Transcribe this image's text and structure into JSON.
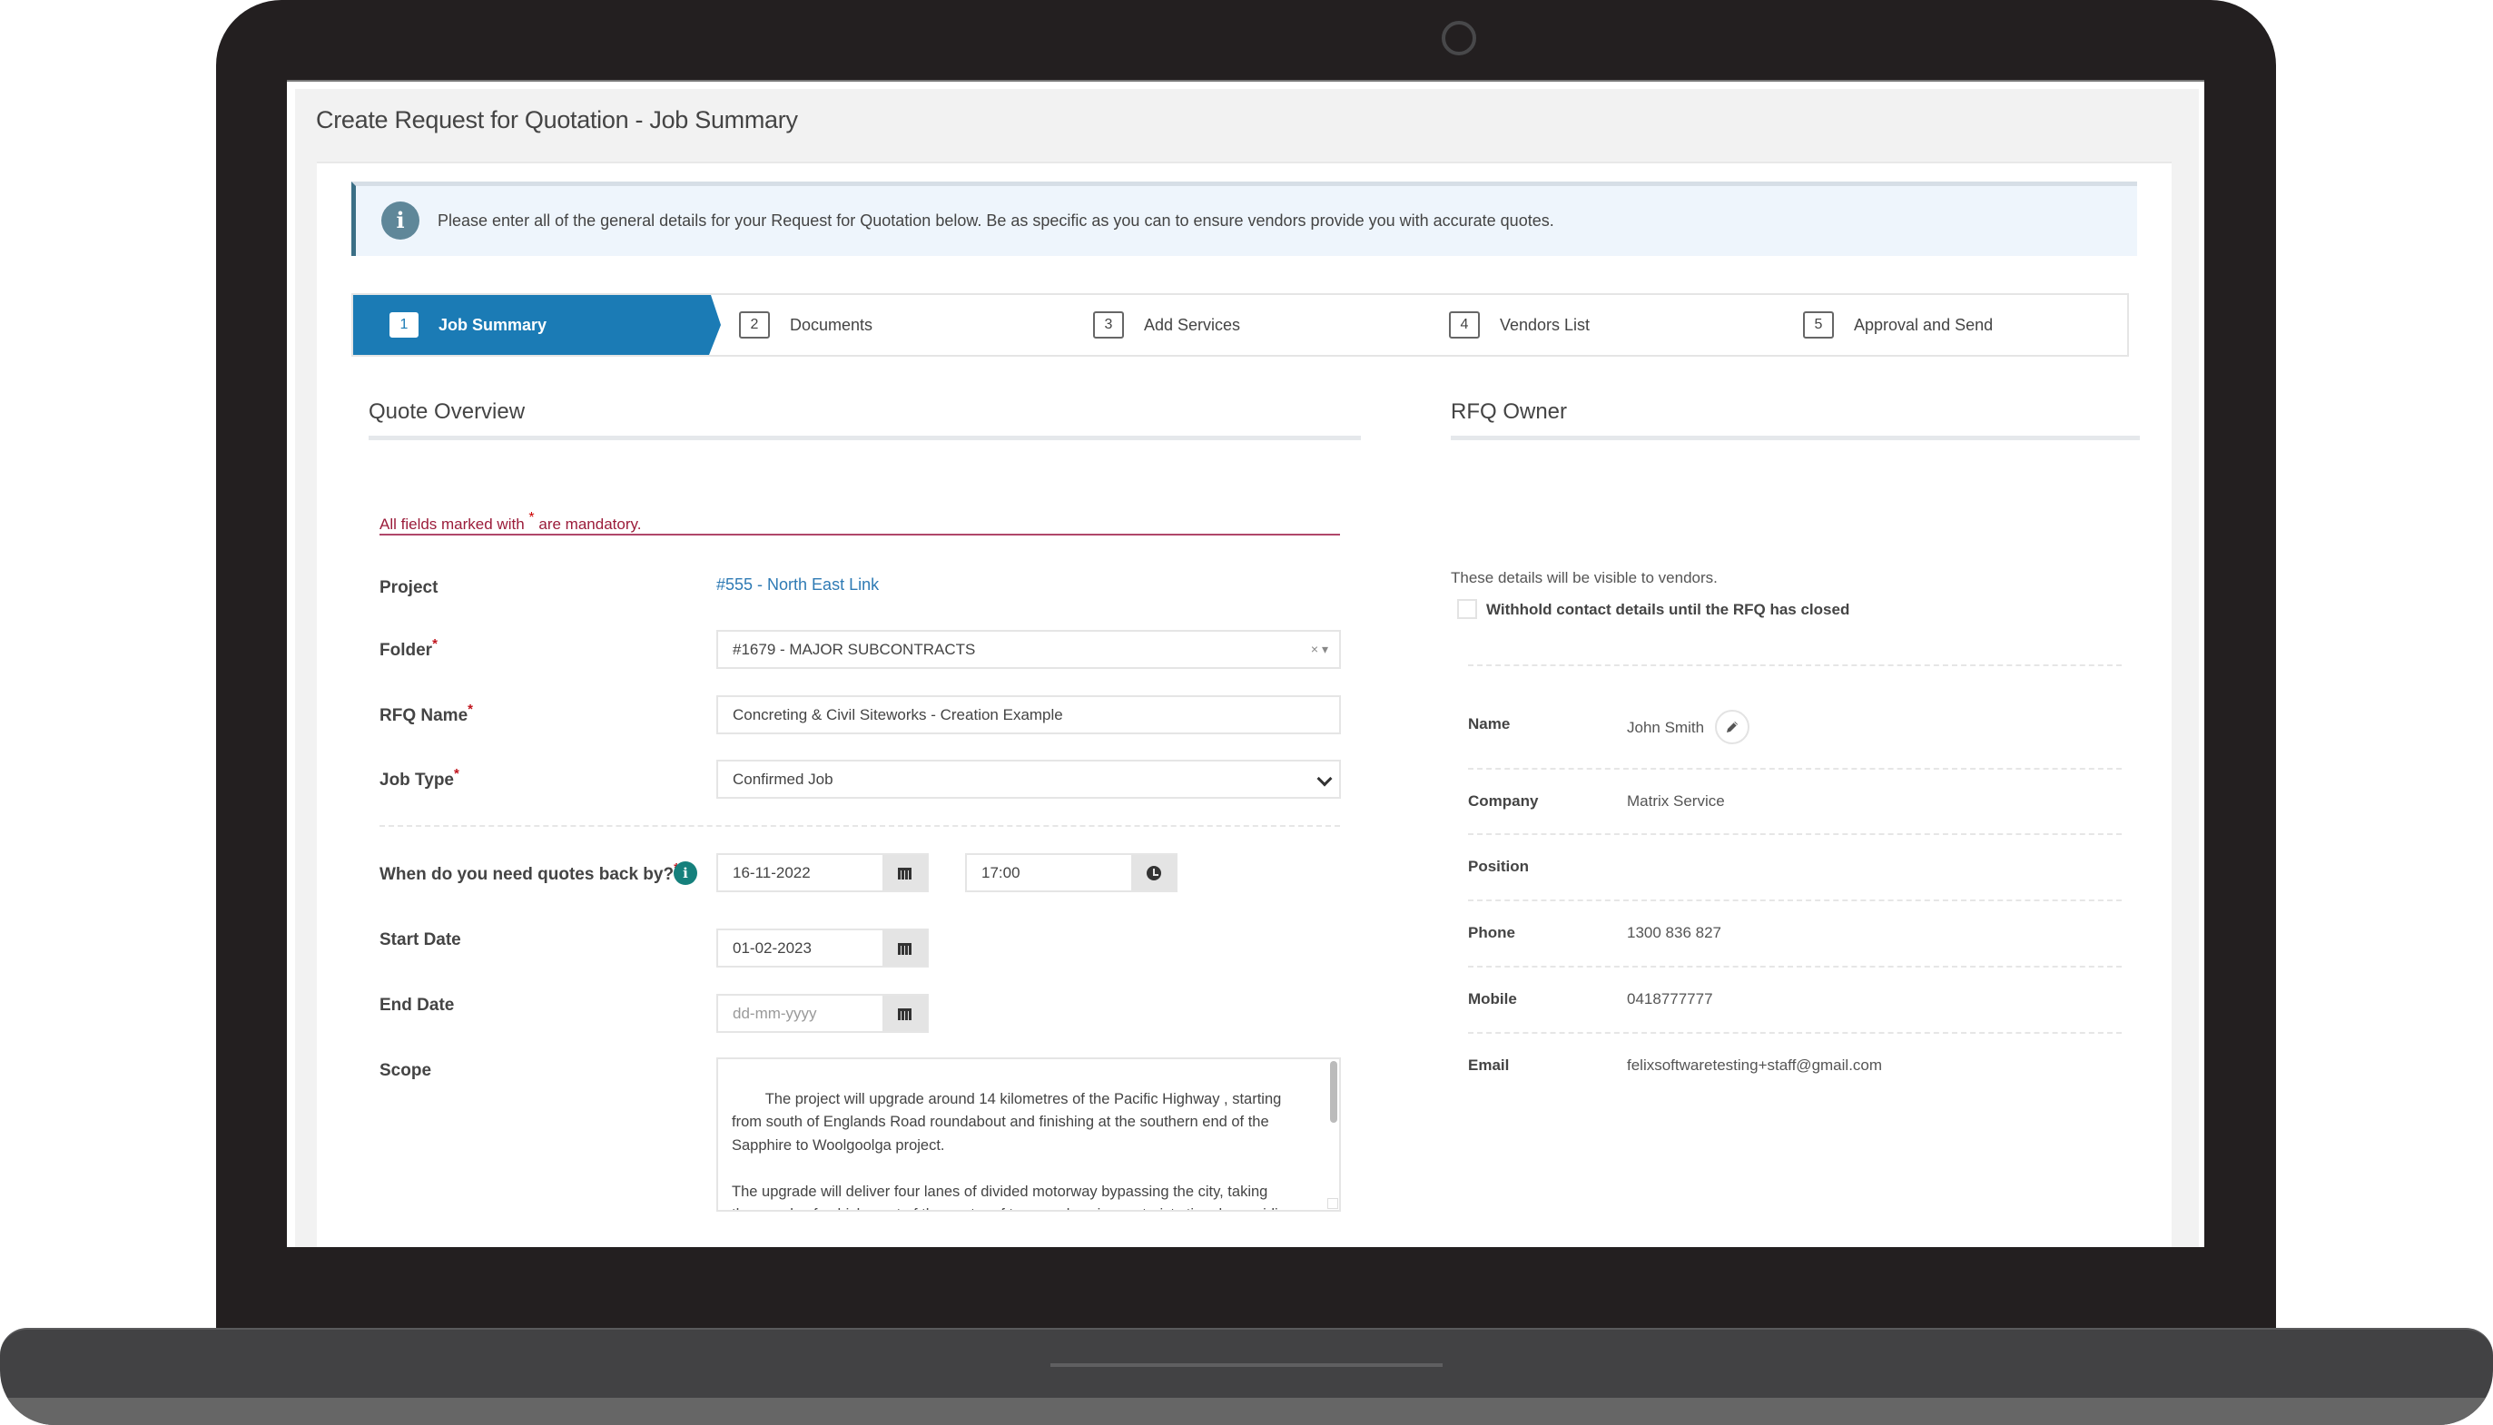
{
  "page": {
    "title": "Create Request for Quotation - Job Summary"
  },
  "banner": {
    "icon": "info-icon",
    "text": "Please enter all of the general details for your Request for Quotation below. Be as specific as you can to ensure vendors provide you with accurate quotes."
  },
  "steps": [
    {
      "num": "1",
      "label": "Job Summary",
      "active": true
    },
    {
      "num": "2",
      "label": "Documents",
      "active": false
    },
    {
      "num": "3",
      "label": "Add Services",
      "active": false
    },
    {
      "num": "4",
      "label": "Vendors List",
      "active": false
    },
    {
      "num": "5",
      "label": "Approval and Send",
      "active": false
    }
  ],
  "quote_overview": {
    "title": "Quote Overview",
    "mandatory_note_before": "All fields marked with",
    "mandatory_star": "*",
    "mandatory_note_after": "are mandatory.",
    "required_marker": "*",
    "project": {
      "label": "Project",
      "value": "#555 - North East Link"
    },
    "folder": {
      "label": "Folder",
      "value": "#1679 - MAJOR SUBCONTRACTS",
      "clear": "×",
      "caret": "▾"
    },
    "rfq_name": {
      "label": "RFQ Name",
      "value": "Concreting & Civil Siteworks - Creation Example"
    },
    "job_type": {
      "label": "Job Type",
      "value": "Confirmed Job"
    },
    "quotes_back_by": {
      "label": "When do you need quotes back by?",
      "date": "16-11-2022",
      "time": "17:00",
      "info": "i"
    },
    "start_date": {
      "label": "Start Date",
      "value": "01-02-2023"
    },
    "end_date": {
      "label": "End Date",
      "placeholder": "dd-mm-yyyy"
    },
    "scope": {
      "label": "Scope",
      "value": "The project will upgrade around 14 kilometres of the Pacific Highway , starting from south of Englands Road roundabout and finishing at the southern end of the Sapphire to Woolgoolga project.\n\nThe upgrade will deliver four lanes of divided motorway bypassing the city, taking thousands of vehicles out of the centre of town and saving motorists time by avoiding ... [text continues, cut off]"
    }
  },
  "rfq_owner": {
    "title": "RFQ Owner",
    "description": "These details will be visible to vendors.",
    "withhold_label": "Withhold contact details until the RFQ has closed",
    "withhold_checked": false,
    "fields": [
      {
        "label": "Name",
        "value": "John Smith"
      },
      {
        "label": "Company",
        "value": "Matrix Service"
      },
      {
        "label": "Position",
        "value": ""
      },
      {
        "label": "Phone",
        "value": "1300 836 827"
      },
      {
        "label": "Mobile",
        "value": "0418777777"
      },
      {
        "label": "Email",
        "value": "felixsoftwaretesting+staff@gmail.com"
      }
    ]
  },
  "colors": {
    "step_active": "#1b7bb5",
    "mandatory": "#9b1c3a",
    "link": "#2e7ab4",
    "info_teal": "#15807c"
  }
}
